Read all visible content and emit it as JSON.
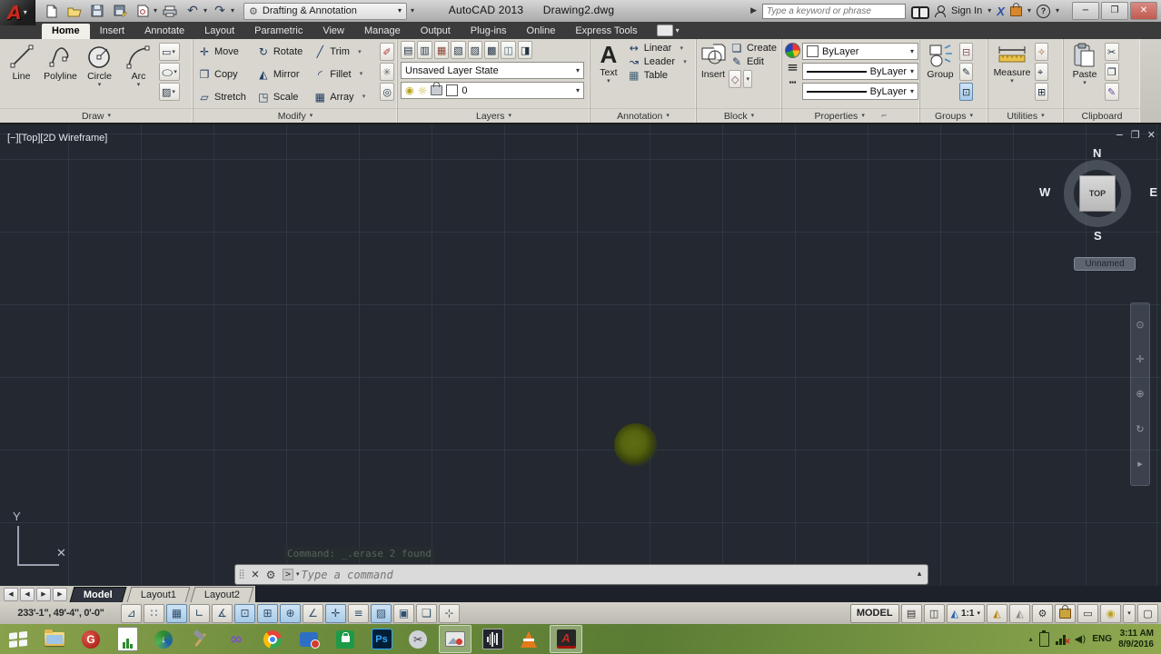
{
  "icons": {
    "dd": "▾",
    "up": "▴",
    "fly": "▶",
    "undo": "↶",
    "redo": "↷",
    "gear": "⚙",
    "min": "−",
    "max": "❐",
    "close": "✕",
    "grip": "⣿",
    "wrench": "⚙",
    "prompt": ">",
    "sun": "☼",
    "bulb": "◉",
    "nav_first": "◀",
    "nav_prev": "◀",
    "nav_next": "▶",
    "nav_last": "▶"
  },
  "glyphs": {
    "move": "✛",
    "rotate": "↻",
    "trim": "╱",
    "copy": "❐",
    "mirror": "◭",
    "fillet": "◜",
    "stretch": "▱",
    "scale": "◳",
    "array": "▦",
    "erase": "✐",
    "explode": "✳",
    "offset": "◎",
    "rect": "▭",
    "ellipse": "◯",
    "hatch": "▨",
    "lineardim": "↔",
    "leader": "↝",
    "table": "▦",
    "lineweight": "≡",
    "linetype": "┅",
    "cut": "✂",
    "copyclip": "❐",
    "matchprops": "✎",
    "qselect": "✧",
    "idpoint": "⌖",
    "qcalc": "⊞",
    "ungroup": "⊟",
    "groupedit": "✎",
    "groupsel": "⊡",
    "create": "❏",
    "edit": "✎",
    "setbase": "◇",
    "layers": [
      "▤",
      "▥",
      "▦",
      "▧",
      "▨",
      "▩",
      "◫",
      "◨"
    ],
    "navs": [
      "⊙",
      "✛",
      "⊕",
      "↻",
      "▸"
    ]
  },
  "titlebar": {
    "workspace": "Drafting & Annotation",
    "app_title": "AutoCAD 2013",
    "doc_title": "Drawing2.dwg",
    "search_placeholder": "Type a keyword or phrase",
    "sign_in": "Sign In"
  },
  "ribbon": {
    "tabs": [
      {
        "label": "Home"
      },
      {
        "label": "Insert"
      },
      {
        "label": "Annotate"
      },
      {
        "label": "Layout"
      },
      {
        "label": "Parametric"
      },
      {
        "label": "View"
      },
      {
        "label": "Manage"
      },
      {
        "label": "Output"
      },
      {
        "label": "Plug-ins"
      },
      {
        "label": "Online"
      },
      {
        "label": "Express Tools"
      }
    ],
    "draw": {
      "label": "Draw",
      "line": "Line",
      "polyline": "Polyline",
      "circle": "Circle",
      "arc": "Arc"
    },
    "modify": {
      "label": "Modify",
      "move": "Move",
      "rotate": "Rotate",
      "trim": "Trim",
      "copy": "Copy",
      "mirror": "Mirror",
      "fillet": "Fillet",
      "stretch": "Stretch",
      "scale": "Scale",
      "array": "Array"
    },
    "layers": {
      "label": "Layers",
      "state": "Unsaved Layer State",
      "current": "0"
    },
    "annotation": {
      "label": "Annotation",
      "text": "Text",
      "linear": "Linear",
      "leader": "Leader",
      "table": "Table"
    },
    "block": {
      "label": "Block",
      "insert": "Insert",
      "create": "Create",
      "edit": "Edit"
    },
    "properties": {
      "label": "Properties",
      "color": "ByLayer",
      "lineweight": "ByLayer",
      "linetype": "ByLayer"
    },
    "groups": {
      "label": "Groups",
      "group": "Group"
    },
    "utilities": {
      "label": "Utilities",
      "measure": "Measure"
    },
    "clipboard": {
      "label": "Clipboard",
      "paste": "Paste"
    }
  },
  "canvas": {
    "viewport_label": "[−][Top][2D Wireframe]",
    "viewcube": {
      "n": "N",
      "e": "E",
      "s": "S",
      "w": "W",
      "top": "TOP",
      "view": "Unnamed"
    },
    "ucs": {
      "x": "X",
      "y": "Y"
    }
  },
  "command": {
    "history": "Command: _.erase 2 found",
    "prompt_placeholder": "Type a command"
  },
  "layout_tabs": {
    "model": "Model",
    "layout1": "Layout1",
    "layout2": "Layout2"
  },
  "statusbar": {
    "coords": "233'-1\", 49'-4\", 0'-0\"",
    "toggles": [
      "⊿",
      "∷",
      "▦",
      "∟",
      "∡",
      "⊡",
      "⊞",
      "⊕",
      "∠",
      "✛",
      "≡",
      "▨",
      "▣",
      "❏",
      "⊹"
    ],
    "model": "MODEL",
    "scale": "1:1"
  },
  "taskbar": {
    "ps_label": "Ps"
  },
  "tray": {
    "lang": "ENG",
    "time": "3:11 AM",
    "date": "8/9/2016"
  }
}
